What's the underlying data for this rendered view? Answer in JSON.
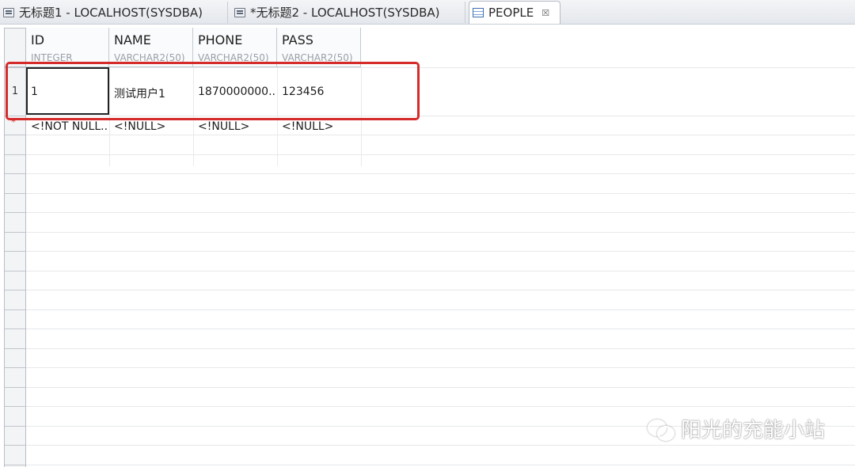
{
  "tabs": [
    {
      "label": "无标题1 - LOCALHOST(SYSDBA)",
      "icon": "sql-editor-icon",
      "active": false
    },
    {
      "label": "*无标题2 - LOCALHOST(SYSDBA)",
      "icon": "sql-editor-icon",
      "active": false
    },
    {
      "label": "PEOPLE",
      "icon": "table-icon",
      "active": true,
      "close": "☒"
    }
  ],
  "columns": [
    {
      "name": "ID",
      "type": "INTEGER"
    },
    {
      "name": "NAME",
      "type": "VARCHAR2(50)"
    },
    {
      "name": "PHONE",
      "type": "VARCHAR2(50)"
    },
    {
      "name": "PASS",
      "type": "VARCHAR2(50)"
    }
  ],
  "rows": [
    {
      "num": "1",
      "cells": [
        "1",
        "测试用户1",
        "1870000000..",
        "123456"
      ]
    }
  ],
  "new_row": {
    "marker": "*",
    "cells": [
      "<!NOT NULL..",
      "<!NULL>",
      "<!NULL>",
      "<!NULL>"
    ]
  },
  "watermark": {
    "text": "阳光的充能小站"
  },
  "colors": {
    "highlight": "#d62b2b",
    "tabbar": "#e4e7ec"
  }
}
